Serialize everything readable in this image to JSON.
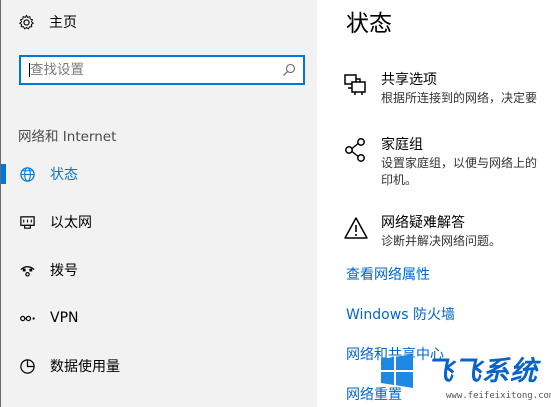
{
  "sidebar": {
    "home_label": "主页",
    "search": {
      "placeholder": "查找设置"
    },
    "section_title": "网络和 Internet",
    "items": [
      {
        "label": "状态",
        "icon": "globe-icon",
        "active": true
      },
      {
        "label": "以太网",
        "icon": "ethernet-icon",
        "active": false
      },
      {
        "label": "拨号",
        "icon": "dialup-icon",
        "active": false
      },
      {
        "label": "VPN",
        "icon": "vpn-icon",
        "active": false
      },
      {
        "label": "数据使用量",
        "icon": "pie-chart-icon",
        "active": false
      }
    ]
  },
  "main": {
    "title": "状态",
    "blocks": [
      {
        "title": "共享选项",
        "desc": "根据所连接到的网络，决定要",
        "icon": "sharing-icon"
      },
      {
        "title": "家庭组",
        "desc": "设置家庭组，以便与网络上的",
        "desc2": "印机。",
        "icon": "homegroup-icon"
      },
      {
        "title": "网络疑难解答",
        "desc": "诊断并解决网络问题。",
        "icon": "warning-icon"
      }
    ],
    "links": {
      "properties": "查看网络属性",
      "firewall": "Windows 防火墙",
      "sharing_center": "网络和共享中心",
      "reset": "网络重置"
    }
  },
  "watermark": {
    "text": "飞飞系统",
    "url": "www.feifeixitong.com"
  },
  "colors": {
    "accent": "#0078d7",
    "link": "#0066cc",
    "sidebar_bg": "#f2f2f2"
  }
}
